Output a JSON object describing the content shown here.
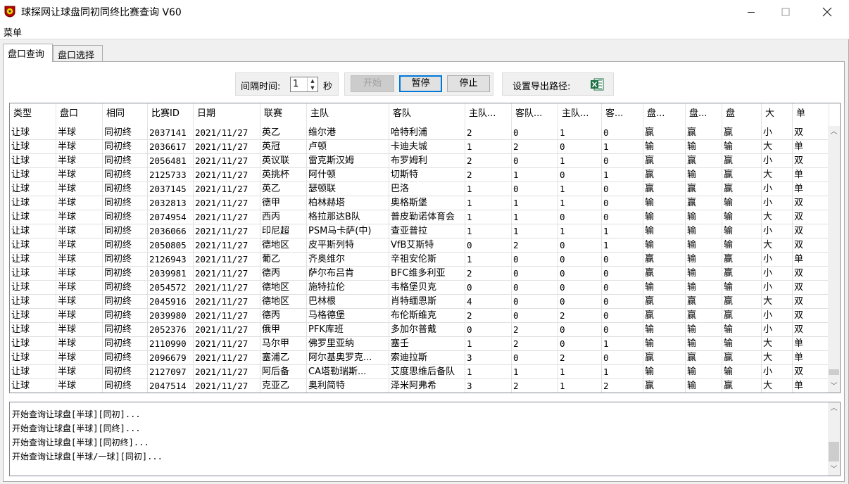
{
  "window": {
    "title": "球探网让球盘同初同终比赛查询 V60"
  },
  "menu": {
    "label": "菜单"
  },
  "tabs": [
    {
      "label": "盘口查询"
    },
    {
      "label": "盘口选择"
    }
  ],
  "controls": {
    "interval_label": "间隔时间:",
    "interval_value": "1",
    "interval_unit": "秒",
    "start_label": "开始",
    "pause_label": "暂停",
    "stop_label": "停止",
    "export_label": "设置导出路径:"
  },
  "table": {
    "columns": [
      "类型",
      "盘口",
      "相同",
      "比赛ID",
      "日期",
      "联赛",
      "主队",
      "客队",
      "主队...",
      "客队...",
      "主队...",
      "客...",
      "盘...",
      "盘...",
      "盘",
      "大",
      "单"
    ],
    "rows": [
      [
        "让球",
        "半球",
        "同初终",
        "2037141",
        "2021/11/27",
        "英乙",
        "维尔港",
        "哈特利浦",
        "2",
        "0",
        "1",
        "0",
        "赢",
        "赢",
        "赢",
        "小",
        "双"
      ],
      [
        "让球",
        "半球",
        "同初终",
        "2036617",
        "2021/11/27",
        "英冠",
        "卢顿",
        "卡迪夫城",
        "1",
        "2",
        "0",
        "1",
        "输",
        "输",
        "输",
        "大",
        "单"
      ],
      [
        "让球",
        "半球",
        "同初终",
        "2056481",
        "2021/11/27",
        "英议联",
        "雷克斯汉姆",
        "布罗姆利",
        "2",
        "0",
        "1",
        "0",
        "赢",
        "赢",
        "赢",
        "小",
        "双"
      ],
      [
        "让球",
        "半球",
        "同初终",
        "2125733",
        "2021/11/27",
        "英挑杯",
        "阿什顿",
        "切斯特",
        "2",
        "1",
        "0",
        "1",
        "赢",
        "输",
        "赢",
        "大",
        "单"
      ],
      [
        "让球",
        "半球",
        "同初终",
        "2037145",
        "2021/11/27",
        "英乙",
        "瑟顿联",
        "巴洛",
        "1",
        "0",
        "1",
        "0",
        "赢",
        "赢",
        "赢",
        "小",
        "单"
      ],
      [
        "让球",
        "半球",
        "同初终",
        "2032813",
        "2021/11/27",
        "德甲",
        "柏林赫塔",
        "奥格斯堡",
        "1",
        "1",
        "1",
        "0",
        "输",
        "赢",
        "输",
        "小",
        "双"
      ],
      [
        "让球",
        "半球",
        "同初终",
        "2074954",
        "2021/11/27",
        "西丙",
        "格拉那达B队",
        "普皮勒诺体育会",
        "1",
        "1",
        "0",
        "0",
        "输",
        "输",
        "输",
        "大",
        "双"
      ],
      [
        "让球",
        "半球",
        "同初终",
        "2036066",
        "2021/11/27",
        "印尼超",
        "PSM马卡萨(中)",
        "查亚普拉",
        "1",
        "1",
        "1",
        "1",
        "输",
        "输",
        "输",
        "小",
        "双"
      ],
      [
        "让球",
        "半球",
        "同初终",
        "2050805",
        "2021/11/27",
        "德地区",
        "皮平斯列特",
        "VfB艾斯特",
        "0",
        "2",
        "0",
        "1",
        "输",
        "输",
        "输",
        "大",
        "双"
      ],
      [
        "让球",
        "半球",
        "同初终",
        "2126943",
        "2021/11/27",
        "葡乙",
        "齐奥维尔",
        "辛祖安伦斯",
        "1",
        "0",
        "0",
        "0",
        "赢",
        "输",
        "赢",
        "小",
        "单"
      ],
      [
        "让球",
        "半球",
        "同初终",
        "2039981",
        "2021/11/27",
        "德丙",
        "萨尔布吕肯",
        "BFC维多利亚",
        "2",
        "0",
        "0",
        "0",
        "赢",
        "输",
        "赢",
        "小",
        "双"
      ],
      [
        "让球",
        "半球",
        "同初终",
        "2054572",
        "2021/11/27",
        "德地区",
        "施特拉伦",
        "韦格堡贝克",
        "0",
        "0",
        "0",
        "0",
        "输",
        "输",
        "输",
        "小",
        "双"
      ],
      [
        "让球",
        "半球",
        "同初终",
        "2045916",
        "2021/11/27",
        "德地区",
        "巴林根",
        "肖特缅恩斯",
        "4",
        "0",
        "0",
        "0",
        "赢",
        "赢",
        "赢",
        "大",
        "双"
      ],
      [
        "让球",
        "半球",
        "同初终",
        "2039980",
        "2021/11/27",
        "德丙",
        "马格德堡",
        "布伦斯维克",
        "2",
        "0",
        "2",
        "0",
        "赢",
        "赢",
        "赢",
        "小",
        "双"
      ],
      [
        "让球",
        "半球",
        "同初终",
        "2052376",
        "2021/11/27",
        "俄甲",
        "PFK库班",
        "多加尔普戴",
        "0",
        "2",
        "0",
        "0",
        "输",
        "输",
        "输",
        "小",
        "双"
      ],
      [
        "让球",
        "半球",
        "同初终",
        "2110990",
        "2021/11/27",
        "马尔甲",
        "佛罗里亚纳",
        "塞壬",
        "1",
        "2",
        "0",
        "1",
        "输",
        "输",
        "输",
        "大",
        "单"
      ],
      [
        "让球",
        "半球",
        "同初终",
        "2096679",
        "2021/11/27",
        "塞浦乙",
        "阿尔基奥罗克...",
        "索迪拉斯",
        "3",
        "0",
        "2",
        "0",
        "赢",
        "赢",
        "赢",
        "大",
        "单"
      ],
      [
        "让球",
        "半球",
        "同初终",
        "2127097",
        "2021/11/27",
        "阿后备",
        "CA塔勒瑞斯...",
        "艾度思维后备队",
        "1",
        "1",
        "1",
        "1",
        "输",
        "输",
        "输",
        "小",
        "双"
      ],
      [
        "让球",
        "半球",
        "同初终",
        "2047514",
        "2021/11/27",
        "克亚乙",
        "奥利简特",
        "泽米阿弗希",
        "3",
        "2",
        "1",
        "2",
        "赢",
        "输",
        "赢",
        "大",
        "单"
      ]
    ]
  },
  "log": [
    "开始查询让球盘[半球][同初]...",
    "开始查询让球盘[半球][同终]...",
    "开始查询让球盘[半球][同初终]...",
    "开始查询让球盘[半球/一球][同初]..."
  ],
  "icons": {
    "app": "football-app-icon",
    "excel": "excel-icon"
  },
  "colors": {
    "excel_green": "#1e7145",
    "focus_blue": "#0078d7"
  }
}
